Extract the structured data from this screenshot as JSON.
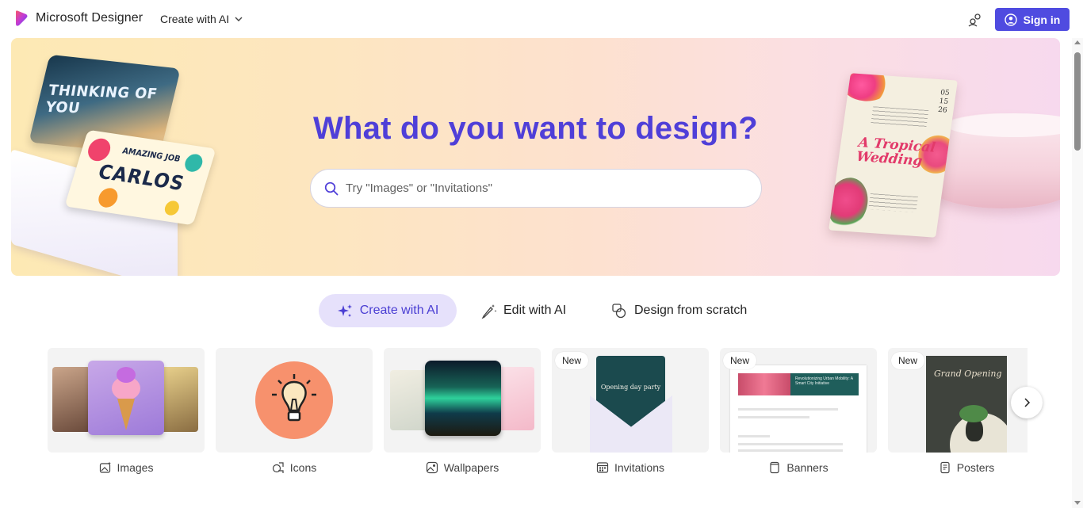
{
  "header": {
    "brand_name": "Microsoft Designer",
    "create_menu_label": "Create with AI",
    "signin_label": "Sign in"
  },
  "hero": {
    "title": "What do you want to design?",
    "search_placeholder": "Try \"Images\" or \"Invitations\"",
    "deco": {
      "card1_text": "THINKING OF YOU",
      "card2_small": "AMAZING JOB",
      "card2_big": "CARLOS",
      "wedding_title": "A Tropical Wedding",
      "wedding_date": "05\n15\n26"
    }
  },
  "modes": [
    {
      "label": "Create with AI",
      "icon": "sparkle-icon",
      "active": true
    },
    {
      "label": "Edit with AI",
      "icon": "magic-pen-icon",
      "active": false
    },
    {
      "label": "Design from scratch",
      "icon": "shapes-icon",
      "active": false
    }
  ],
  "categories": [
    {
      "label": "Images",
      "icon": "image-sparkle-icon",
      "badge": ""
    },
    {
      "label": "Icons",
      "icon": "icons-icon",
      "badge": ""
    },
    {
      "label": "Wallpapers",
      "icon": "wallpaper-icon",
      "badge": ""
    },
    {
      "label": "Invitations",
      "icon": "calendar-icon",
      "badge": "New",
      "thumb_text": "Opening day party"
    },
    {
      "label": "Banners",
      "icon": "banner-icon",
      "badge": "New",
      "thumb_text": "Revolutionizing Urban Mobility: A Smart City Initiative"
    },
    {
      "label": "Posters",
      "icon": "poster-icon",
      "badge": "New",
      "thumb_text": "Grand Opening"
    }
  ],
  "colors": {
    "accent": "#4f4be0",
    "hero_title": "#4f3fd8",
    "active_tab_bg": "#e6e1fb"
  }
}
